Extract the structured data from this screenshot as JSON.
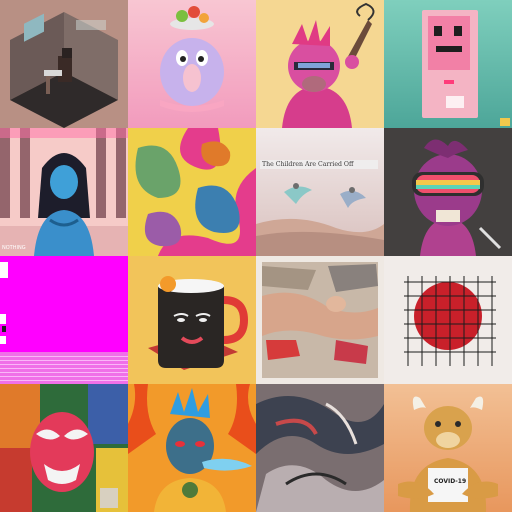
{
  "grid": {
    "columns": 4,
    "rows": 4,
    "tiles": [
      {
        "name": "isometric-room-art",
        "text": ""
      },
      {
        "name": "donut-fruit-bowl-art",
        "text": ""
      },
      {
        "name": "pink-ape-whip-art",
        "text": ""
      },
      {
        "name": "pink-robot-poster-art",
        "text": ""
      },
      {
        "name": "blue-girl-pool-art",
        "text": "NOTHING"
      },
      {
        "name": "psychedelic-blobs-art",
        "text": ""
      },
      {
        "name": "children-carried-off-art",
        "text": "The Children Are Carried Off"
      },
      {
        "name": "purple-alien-goggles-art",
        "text": ""
      },
      {
        "name": "magenta-pixel-art",
        "text": ""
      },
      {
        "name": "coffee-mug-character-art",
        "text": ""
      },
      {
        "name": "collage-figure-art",
        "text": ""
      },
      {
        "name": "red-circle-grid-art",
        "text": ""
      },
      {
        "name": "luchador-mask-art",
        "text": ""
      },
      {
        "name": "blue-devil-fire-art",
        "text": ""
      },
      {
        "name": "abstract-strokes-art",
        "text": ""
      },
      {
        "name": "doge-bull-covid-art",
        "text": "COVID-19"
      }
    ]
  },
  "colors": {
    "pink_bg": "#f6b6c8",
    "magenta": "#ff00ff",
    "mustard": "#f0c64e",
    "teal": "#7ac7b8"
  }
}
